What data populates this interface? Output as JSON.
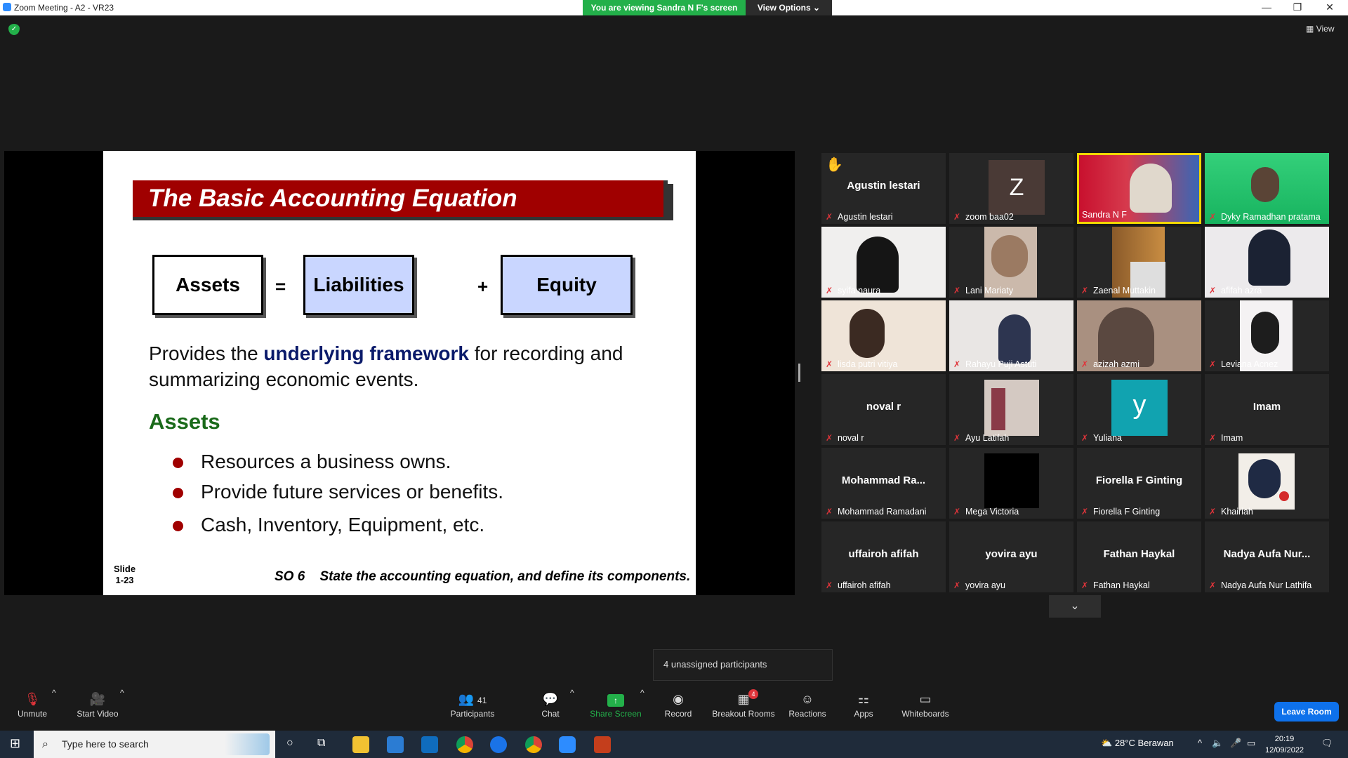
{
  "window": {
    "title": "Zoom Meeting - A2 - VR23",
    "viewing_banner": "You are viewing Sandra N F's screen",
    "view_options": "View Options",
    "view_label": "View"
  },
  "slide": {
    "title": "The Basic Accounting Equation",
    "box_assets": "Assets",
    "op_equals": "=",
    "box_liabilities": "Liabilities",
    "op_plus": "+",
    "box_equity": "Equity",
    "para_pre": "Provides the ",
    "para_highlight": "underlying framework",
    "para_post": " for recording and summarizing economic events.",
    "assets_heading": "Assets",
    "bullets": [
      "Resources a business owns.",
      "Provide future services or benefits.",
      "Cash, Inventory, Equipment, etc."
    ],
    "slide_label": "Slide",
    "slide_number": "1-23",
    "so_label": "SO 6",
    "so_text": "State the accounting equation, and define its components."
  },
  "participants_grid": [
    {
      "name": "Agustin lestari",
      "display": "Agustin lestari",
      "type": "name",
      "hand": true
    },
    {
      "name": "zoom baa02",
      "display": "Z",
      "type": "avatar",
      "color": "#4a3a36"
    },
    {
      "name": "Sandra N F",
      "type": "video",
      "active": true
    },
    {
      "name": "Dyky Ramadhan pratama",
      "type": "video"
    },
    {
      "name": "syifa naura",
      "type": "video"
    },
    {
      "name": "Lani Mariaty",
      "type": "video"
    },
    {
      "name": "Zaenal Muttakin",
      "type": "video"
    },
    {
      "name": "afifah azra",
      "type": "video"
    },
    {
      "name": "lisda putri vitiya",
      "type": "video"
    },
    {
      "name": "Rahayu Puji Astuti",
      "type": "video"
    },
    {
      "name": "azizah azmi",
      "type": "video"
    },
    {
      "name": "Leviana Acnez",
      "type": "video"
    },
    {
      "name": "noval r",
      "display": "noval r",
      "type": "name"
    },
    {
      "name": "Ayu Latifah",
      "type": "video"
    },
    {
      "name": "Yuliana",
      "display": "y",
      "type": "avatar",
      "color": "#11a3b0"
    },
    {
      "name": "Imam",
      "display": "Imam",
      "type": "name"
    },
    {
      "name": "Mohammad Ramadani",
      "display": "Mohammad  Ra...",
      "type": "name"
    },
    {
      "name": "Mega Victoria",
      "type": "video"
    },
    {
      "name": "Fiorella F Ginting",
      "display": "Fiorella F Ginting",
      "type": "name"
    },
    {
      "name": "Khairiah",
      "type": "video"
    },
    {
      "name": "uffairoh afifah",
      "display": "uffairoh afifah",
      "type": "name"
    },
    {
      "name": "yovira ayu",
      "display": "yovira ayu",
      "type": "name"
    },
    {
      "name": "Fathan Haykal",
      "display": "Fathan Haykal",
      "type": "name"
    },
    {
      "name": "Nadya Aufa Nur Lathifa",
      "display": "Nadya  Aufa  Nur...",
      "type": "name"
    }
  ],
  "unassigned": "4 unassigned participants",
  "toolbar": {
    "unmute": "Unmute",
    "start_video": "Start Video",
    "participants": "Participants",
    "participants_count": "41",
    "chat": "Chat",
    "share_screen": "Share Screen",
    "record": "Record",
    "breakout_rooms": "Breakout Rooms",
    "breakout_badge": "4",
    "reactions": "Reactions",
    "apps": "Apps",
    "whiteboards": "Whiteboards",
    "leave_room": "Leave Room"
  },
  "taskbar": {
    "search_placeholder": "Type here to search",
    "weather": "28°C  Berawan",
    "time": "20:19",
    "date": "12/09/2022"
  },
  "colors": {
    "accent_green": "#23b04a",
    "active_speaker": "#f2d700",
    "leave_blue": "#0e71eb",
    "slide_title_red": "#a00000"
  }
}
